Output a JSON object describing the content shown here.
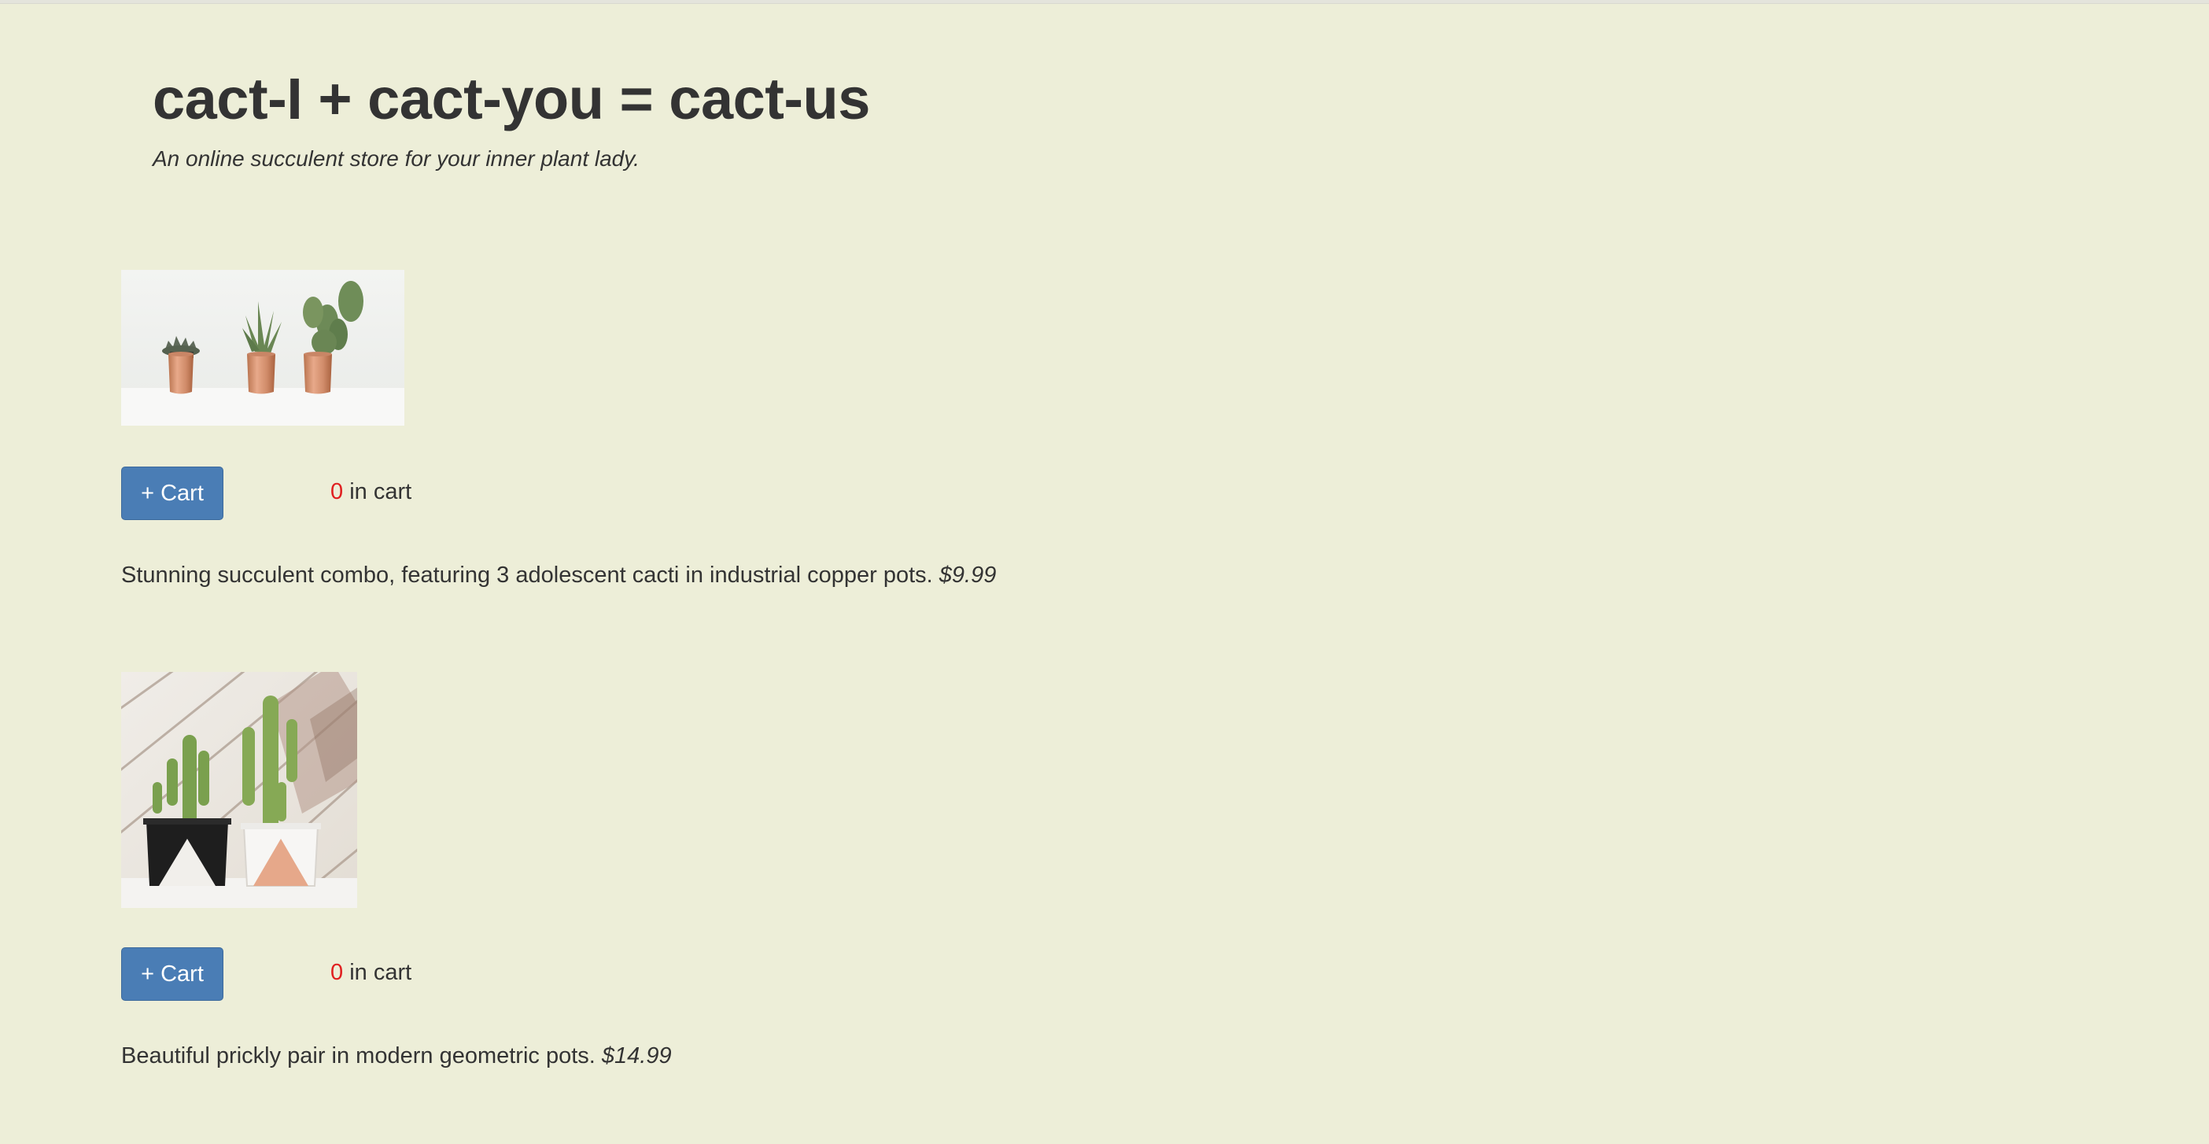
{
  "header": {
    "title": "cact-I + cact-you = cact-us",
    "tagline": "An online succulent store for your inner plant lady."
  },
  "products": [
    {
      "image_label": "three succulents in copper pots",
      "add_button_label": "+ Cart",
      "cart_count": "0",
      "cart_suffix": "in cart",
      "description": "Stunning succulent combo, featuring 3 adolescent cacti in industrial copper pots.",
      "price": "$9.99"
    },
    {
      "image_label": "two cacti in geometric pots",
      "add_button_label": "+ Cart",
      "cart_count": "0",
      "cart_suffix": "in cart",
      "description": "Beautiful prickly pair in modern geometric pots.",
      "price": "$14.99"
    }
  ],
  "colors": {
    "background": "#edeed8",
    "button": "#4a7db5",
    "cart_count": "#e02020",
    "text": "#333333"
  }
}
